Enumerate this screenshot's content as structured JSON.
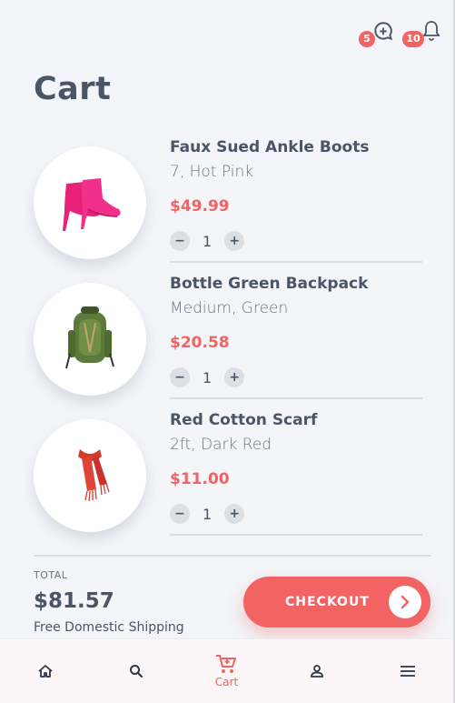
{
  "header": {
    "chat_badge": "5",
    "notif_badge": "10",
    "chat_icon": "chat-plus-icon",
    "notif_icon": "bell-icon"
  },
  "page_title": "Cart",
  "items": [
    {
      "name": "Faux Sued Ankle Boots",
      "variant": "7, Hot Pink",
      "price": "$49.99",
      "qty": "1",
      "image": "pink-ankle-boots"
    },
    {
      "name": "Bottle Green Backpack",
      "variant": "Medium, Green",
      "price": "$20.58",
      "qty": "1",
      "image": "green-backpack"
    },
    {
      "name": "Red Cotton Scarf",
      "variant": "2ft, Dark Red",
      "price": "$11.00",
      "qty": "1",
      "image": "red-scarf"
    }
  ],
  "summary": {
    "total_label": "TOTAL",
    "total_value": "$81.57",
    "shipping": "Free Domestic Shipping",
    "checkout_label": "CHECKOUT"
  },
  "nav": {
    "cart_label": "Cart",
    "active": "cart"
  },
  "colors": {
    "accent": "#f26464",
    "text": "#4a5568",
    "background": "#f3f5f8"
  }
}
